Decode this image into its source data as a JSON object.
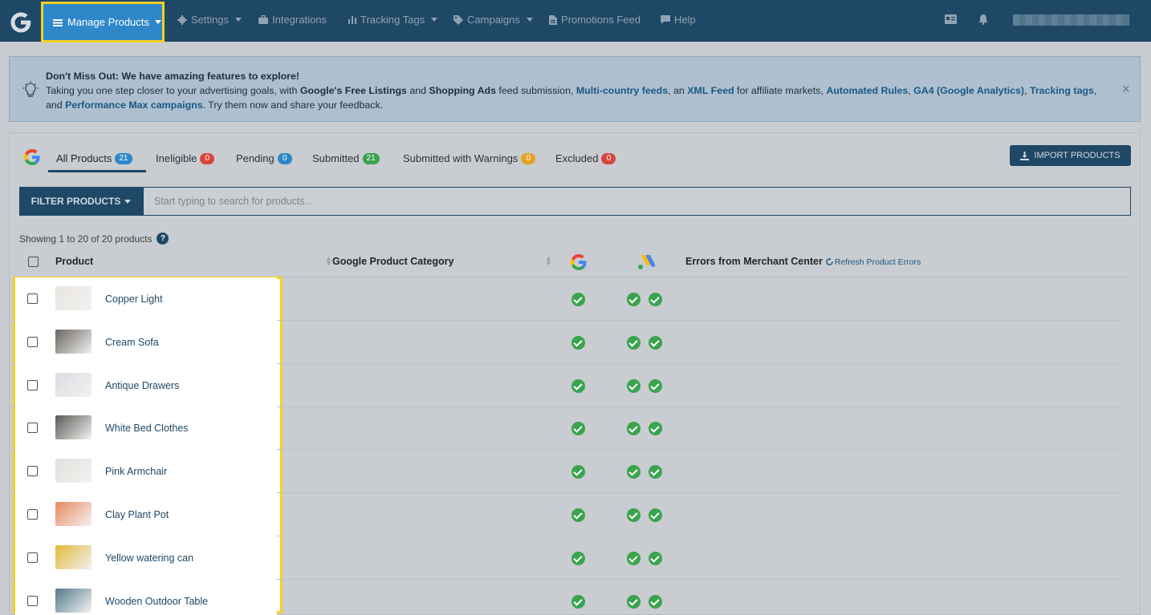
{
  "topbar": {
    "nav": [
      {
        "label": "Manage Products",
        "icon": "list-icon",
        "active": true
      },
      {
        "label": "Settings",
        "icon": "gear-icon"
      },
      {
        "label": "Integrations",
        "icon": "briefcase-icon"
      },
      {
        "label": "Tracking Tags",
        "icon": "bar-chart-icon"
      },
      {
        "label": "Campaigns",
        "icon": "tag-icon"
      },
      {
        "label": "Promotions Feed",
        "icon": "document-icon"
      },
      {
        "label": "Help",
        "icon": "comment-icon"
      }
    ]
  },
  "notice": {
    "title": "Don't Miss Out: We have amazing features to explore!",
    "t1": "Taking you one step closer to your advertising goals, with ",
    "b1": "Google's Free Listings",
    "t2": " and ",
    "b2": "Shopping Ads",
    "t3": " feed submission, ",
    "l1": "Multi-country feeds",
    "t4": ", an ",
    "l2": "XML Feed",
    "t5": " for affiliate markets, ",
    "l3": "Automated Rules",
    "t6": ", ",
    "l4": "GA4 (Google Analytics)",
    "t7": ", ",
    "l5": "Tracking tags",
    "t8": ", and ",
    "l6": "Performance Max campaigns",
    "t9": ". Try them now and share your feedback.",
    "close": "×"
  },
  "tabs": [
    {
      "label": "All Products",
      "count": "21",
      "color": "#2e87c8"
    },
    {
      "label": "Ineligible",
      "count": "0",
      "color": "#d9453d"
    },
    {
      "label": "Pending",
      "count": "0",
      "color": "#2e87c8"
    },
    {
      "label": "Submitted",
      "count": "21",
      "color": "#3aa34e"
    },
    {
      "label": "Submitted with Warnings",
      "count": "0",
      "color": "#e3a124"
    },
    {
      "label": "Excluded",
      "count": "0",
      "color": "#d9453d"
    }
  ],
  "import_label": "IMPORT PRODUCTS",
  "filter_label": "FILTER PRODUCTS",
  "search_placeholder": "Start typing to search for products...",
  "showing": "Showing 1 to 20 of 20 products",
  "help": "?",
  "table": {
    "col_product": "Product",
    "col_category": "Google Product Category",
    "col_errors": "Errors from Merchant Center",
    "refresh": "Refresh Product Errors"
  },
  "products": [
    {
      "name": "Copper Light",
      "thumb": "#e8e4e0"
    },
    {
      "name": "Cream Sofa",
      "thumb": "#6a6560"
    },
    {
      "name": "Antique Drawers",
      "thumb": "#d9dde2"
    },
    {
      "name": "White Bed Clothes",
      "thumb": "#5c5956"
    },
    {
      "name": "Pink Armchair",
      "thumb": "#dfe0dc"
    },
    {
      "name": "Clay Plant Pot",
      "thumb": "#e9895e"
    },
    {
      "name": "Yellow watering can",
      "thumb": "#e0b83a"
    },
    {
      "name": "Wooden Outdoor Table",
      "thumb": "#557a8c"
    }
  ],
  "colors": {
    "navy": "#1f4766",
    "accent": "#2e87c8",
    "highlight": "#f5d020",
    "success": "#3aa34e"
  }
}
